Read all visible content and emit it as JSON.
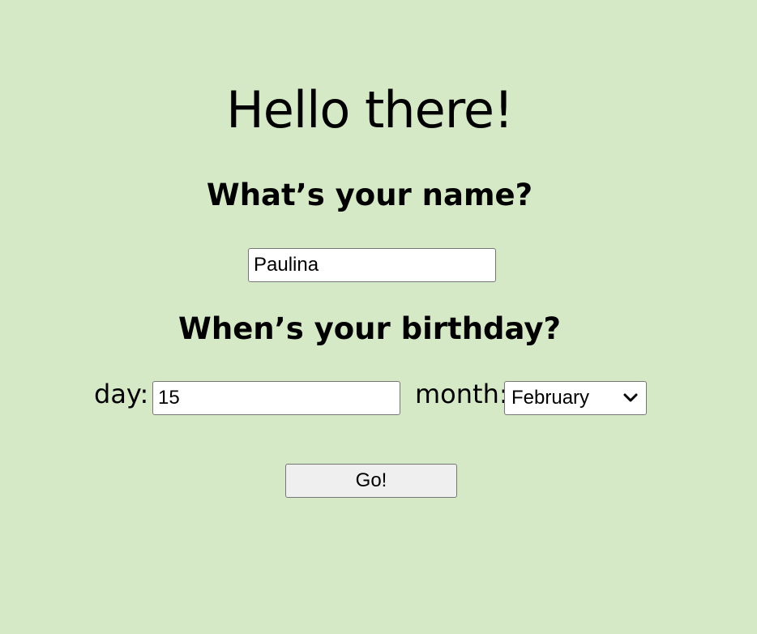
{
  "heading": "Hello there!",
  "name_question": "What’s your name?",
  "name_input": {
    "value": "Paulina"
  },
  "birthday_question": "When’s your birthday?",
  "day": {
    "label": "day:",
    "value": "15"
  },
  "month": {
    "label": "month:",
    "selected": "February",
    "icon": "chevron-down-icon"
  },
  "submit_label": "Go!",
  "colors": {
    "background": "#d6e9c6"
  }
}
